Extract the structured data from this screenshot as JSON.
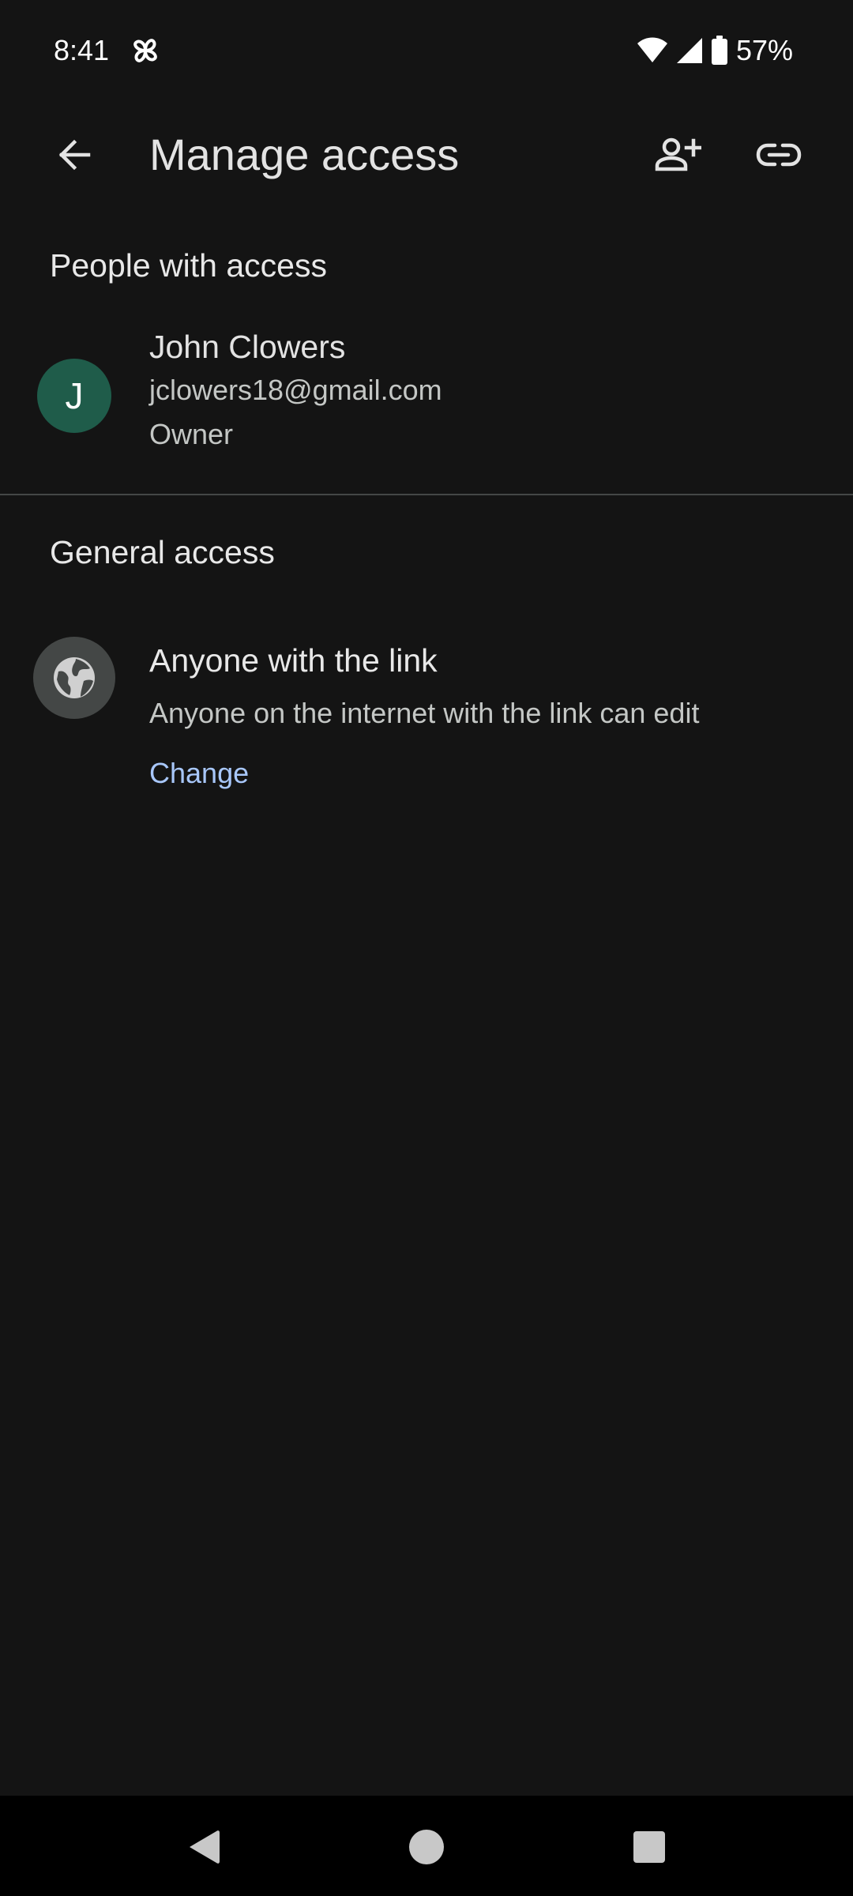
{
  "status_bar": {
    "time": "8:41",
    "battery": "57%",
    "icons": [
      "pinwheel-icon",
      "wifi-icon",
      "signal-icon",
      "battery-icon"
    ]
  },
  "app_bar": {
    "title": "Manage access",
    "icons": [
      "back-arrow-icon",
      "add-person-icon",
      "link-icon"
    ]
  },
  "people_section": {
    "heading": "People with access",
    "people": [
      {
        "initial": "J",
        "name": "John Clowers",
        "email": "jclowers18@gmail.com",
        "role": "Owner",
        "avatar_color": "#1f5c4a"
      }
    ]
  },
  "general_section": {
    "heading": "General access",
    "setting_title": "Anyone with the link",
    "setting_description": "Anyone on the internet with the link can edit",
    "change_label": "Change",
    "icon": "globe-icon"
  },
  "nav_bar": {
    "icons": [
      "back-triangle-icon",
      "home-circle-icon",
      "recents-square-icon"
    ]
  },
  "colors": {
    "background": "#141414",
    "link": "#a8c7fa",
    "divider": "#444746"
  }
}
